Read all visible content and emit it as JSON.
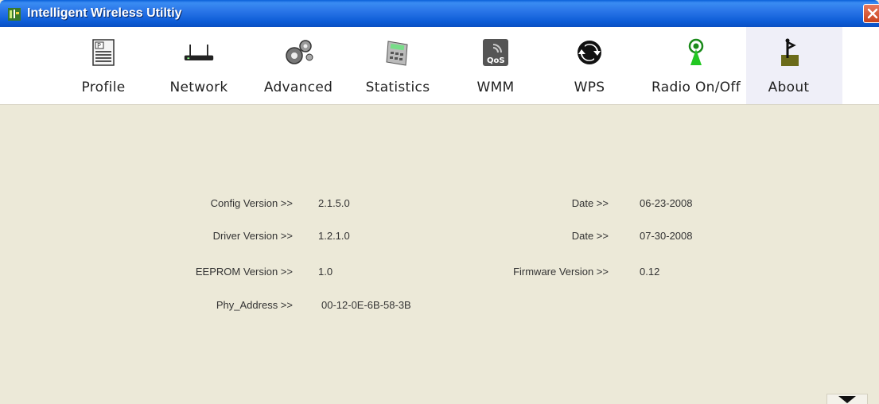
{
  "window": {
    "title": "Intelligent Wireless Utiltiy"
  },
  "toolbar": {
    "items": [
      {
        "label": "Profile",
        "icon": "profile-icon"
      },
      {
        "label": "Network",
        "icon": "network-router-icon"
      },
      {
        "label": "Advanced",
        "icon": "gears-icon"
      },
      {
        "label": "Statistics",
        "icon": "calculator-icon"
      },
      {
        "label": "WMM",
        "icon": "qos-icon"
      },
      {
        "label": "WPS",
        "icon": "wps-icon"
      },
      {
        "label": "Radio On/Off",
        "icon": "radio-antenna-icon"
      },
      {
        "label": "About",
        "icon": "about-icon"
      }
    ],
    "selected": "About"
  },
  "about": {
    "config_version_label": "Config Version >>",
    "config_version_value": "2.1.5.0",
    "config_date_label": "Date >>",
    "config_date_value": "06-23-2008",
    "driver_version_label": "Driver Version >>",
    "driver_version_value": "1.2.1.0",
    "driver_date_label": "Date >>",
    "driver_date_value": "07-30-2008",
    "eeprom_version_label": "EEPROM Version >>",
    "eeprom_version_value": "1.0",
    "firmware_version_label": "Firmware Version >>",
    "firmware_version_value": "0.12",
    "phy_address_label": "Phy_Address >>",
    "phy_address_value": "00-12-0E-6B-58-3B"
  },
  "colors": {
    "titlebar": "#0d5cd6",
    "content_bg": "#ece9d8",
    "toolbar_bg": "#ffffff",
    "close": "#d9542f"
  }
}
